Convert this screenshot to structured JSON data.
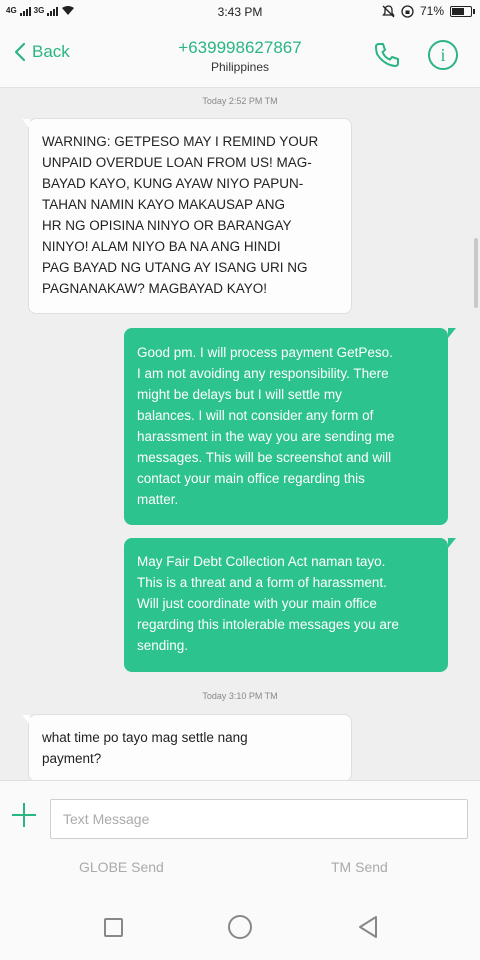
{
  "status_bar": {
    "network_left": "4G",
    "network_right": "3G",
    "time": "3:43 PM",
    "battery": "71%",
    "battery_level": 0.71
  },
  "header": {
    "back_label": "Back",
    "contact_number": "+639998627867",
    "contact_country": "Philippines",
    "accent_color": "#2bb583"
  },
  "messages": [
    {
      "type": "timestamp",
      "text": "Today 2:52 PM  TM"
    },
    {
      "type": "incoming",
      "lines": [
        "WARNING: GETPESO MAY I REMIND YOUR",
        "UNPAID OVERDUE LOAN FROM US! MAG-",
        "BAYAD KAYO, KUNG AYAW NIYO PAPUN-",
        "TAHAN NAMIN KAYO MAKAUSAP ANG",
        "HR NG OPISINA NINYO OR BARANGAY",
        "NINYO! ALAM NIYO BA NA ANG HINDI",
        "PAG BAYAD NG UTANG AY ISANG URI NG",
        "PAGNANAKAW? MAGBAYAD KAYO!"
      ]
    },
    {
      "type": "outgoing",
      "lines": [
        "Good pm. I will process payment GetPeso.",
        "I am not avoiding any responsibility. There",
        "might be delays but I will settle my",
        "balances. I will not consider any form of",
        "harassment in the way you are sending me",
        "messages. This will be screenshot and will",
        "contact your main office regarding this",
        "matter."
      ]
    },
    {
      "type": "outgoing",
      "lines": [
        "May Fair Debt Collection Act naman tayo.",
        "This is a threat and a form of harassment.",
        "Will just coordinate with your main office",
        "regarding this intolerable messages you are",
        "sending."
      ]
    },
    {
      "type": "timestamp",
      "text": "Today 3:10 PM  TM"
    },
    {
      "type": "incoming",
      "lines": [
        "what time po tayo mag settle nang",
        "payment?"
      ]
    }
  ],
  "composer": {
    "placeholder": "Text Message",
    "value": "",
    "send_globe": "GLOBE Send",
    "send_tm": "TM Send"
  },
  "colors": {
    "outgoing_bubble": "#2dc38e",
    "incoming_bubble": "#fdfdfd",
    "background": "#efefef"
  }
}
